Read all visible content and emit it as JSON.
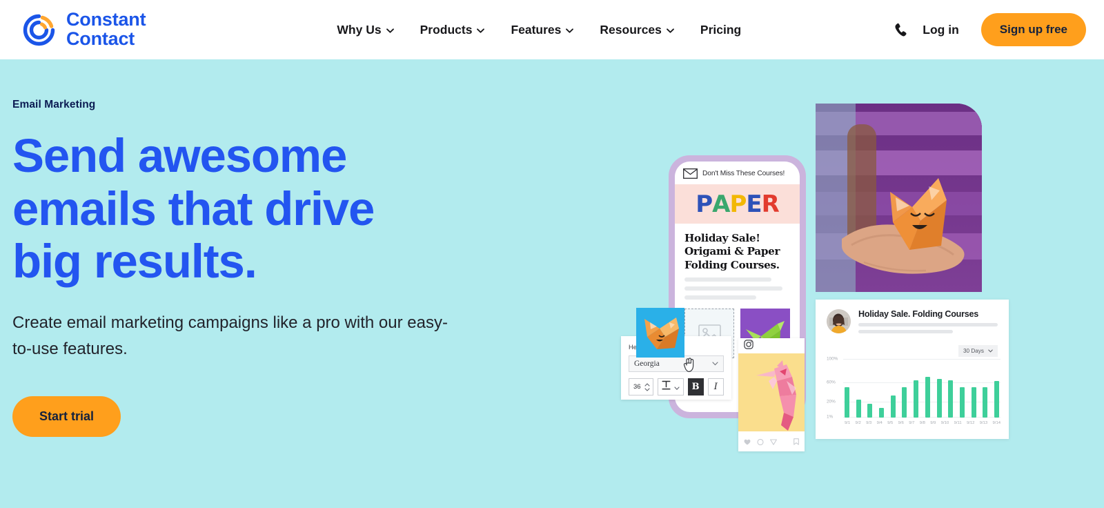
{
  "header": {
    "logo": {
      "line1": "Constant",
      "line2": "Contact",
      "icon": "constant-contact-logo-icon"
    },
    "nav": [
      {
        "label": "Why Us",
        "has_caret": true
      },
      {
        "label": "Products",
        "has_caret": true
      },
      {
        "label": "Features",
        "has_caret": true
      },
      {
        "label": "Resources",
        "has_caret": true
      },
      {
        "label": "Pricing",
        "has_caret": false
      }
    ],
    "phone_icon": "phone-icon",
    "login_label": "Log in",
    "signup_label": "Sign up free"
  },
  "hero": {
    "eyebrow": "Email Marketing",
    "headline": "Send awesome emails that drive big results.",
    "subhead": "Create email marketing campaigns like a pro with our easy-to-use features.",
    "cta_label": "Start trial",
    "background": "#b2ebee",
    "headline_color": "#2355f0",
    "accent_color": "#ff9f1c"
  },
  "art": {
    "phone": {
      "mail_preview": "Don't Miss These Courses!",
      "brand_logo": "PAPER",
      "brand_letters": [
        {
          "ch": "P",
          "color": "#2e52b8"
        },
        {
          "ch": "A",
          "color": "#3aa76d"
        },
        {
          "ch": "P",
          "color": "#f2b705"
        },
        {
          "ch": "E",
          "color": "#2e52b8"
        },
        {
          "ch": "R",
          "color": "#e23b2e"
        }
      ],
      "email_headline": "Holiday Sale! Origami & Paper Folding Courses."
    },
    "editor": {
      "label": "Heading",
      "font_value": "Georgia",
      "size_value": "36",
      "bold_label": "B",
      "italic_label": "I"
    },
    "instagram": {
      "icon": "instagram-icon"
    },
    "analytics": {
      "title": "Holiday Sale. Folding Courses",
      "range_label": "30 Days"
    }
  },
  "chart_data": {
    "type": "bar",
    "title": "Holiday Sale. Folding Courses",
    "xlabel": "",
    "ylabel": "",
    "ylim": [
      0,
      100
    ],
    "grid": true,
    "legend": "none",
    "ytick_labels": [
      "100%",
      "60%",
      "20%",
      "1%"
    ],
    "ytick_values": [
      100,
      60,
      20,
      1
    ],
    "categories": [
      "9/1",
      "9/2",
      "9/3",
      "9/4",
      "9/5",
      "9/6",
      "9/7",
      "9/8",
      "9/9",
      "9/10",
      "9/11",
      "9/12",
      "9/13",
      "9/14"
    ],
    "values": [
      52,
      31,
      23,
      17,
      38,
      52,
      64,
      70,
      66,
      63,
      52,
      52,
      52,
      62
    ],
    "series_color": "#3ecf9a"
  }
}
